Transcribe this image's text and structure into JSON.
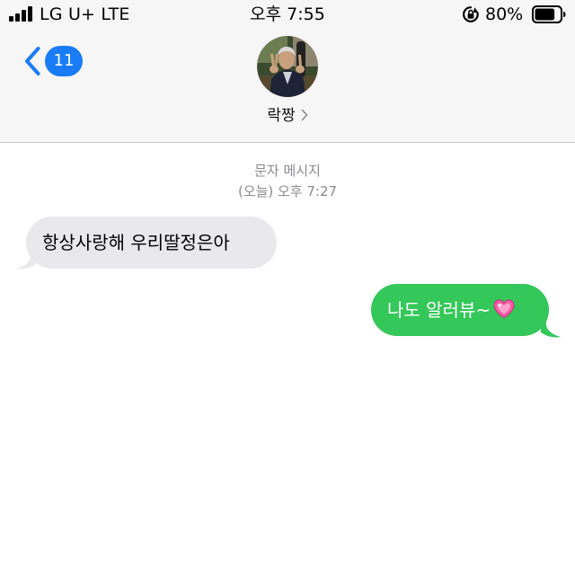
{
  "status_bar": {
    "carrier": "LG U+ LTE",
    "time": "오후 7:55",
    "battery_percent": "80%",
    "battery_level": 0.8,
    "signal_bars": 4,
    "icons": [
      "signal-bars-icon",
      "rotation-lock-icon",
      "battery-icon"
    ]
  },
  "nav": {
    "back_count": "11",
    "contact_name": "락짱",
    "icons": [
      "back-chevron-icon",
      "contact-avatar",
      "chevron-right-icon"
    ]
  },
  "thread": {
    "message_type": "문자 메시지",
    "timestamp": "(오늘) 오후 7:27",
    "messages": [
      {
        "direction": "incoming",
        "text": "항상사랑해  우리딸정은아"
      },
      {
        "direction": "outgoing",
        "text": "나도 알러뷰~",
        "emoji": "sparkling-heart-icon"
      }
    ]
  },
  "colors": {
    "incoming_bubble": "#e9e9eb",
    "outgoing_bubble": "#34c759",
    "accent_blue": "#1a7cf5",
    "meta_gray": "#8a8a8e"
  }
}
